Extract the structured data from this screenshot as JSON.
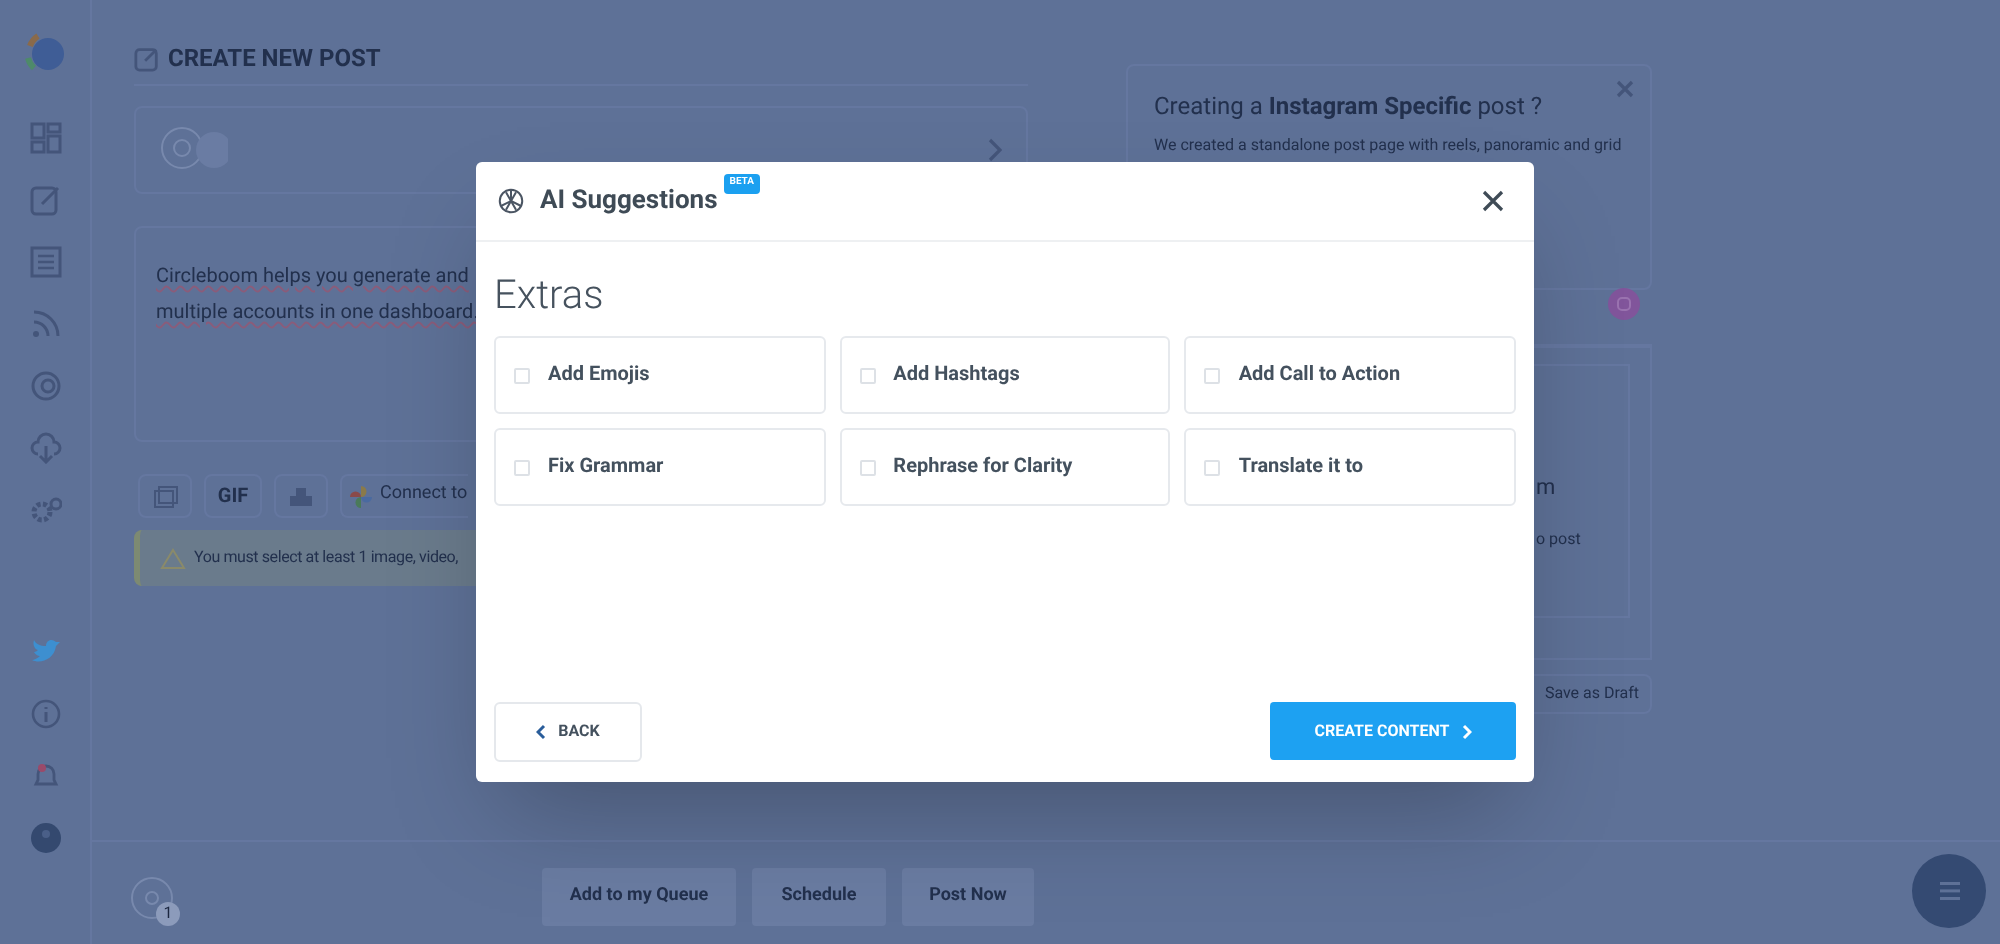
{
  "page": {
    "title": "CREATE NEW POST",
    "editor_text_lines": [
      "Circleboom helps you generate and",
      "multiple accounts in one dashboard."
    ],
    "toolbar": [
      "GIF",
      "Connect to"
    ],
    "warning": "You must select at least 1 image, video,",
    "actions": [
      "Add to my Queue",
      "Schedule",
      "Post Now"
    ],
    "account_badge": "1"
  },
  "promo": {
    "title": "Creating a **Instagram Specific** post ?",
    "text": "We created a standalone post page with reels, panoramic and grid",
    "fragments": [
      "m",
      "o post"
    ],
    "draft_button": "Save as Draft"
  },
  "modal": {
    "title": "AI Suggestions",
    "badge": "BETA",
    "section": "Extras",
    "options": [
      {
        "label": "Add Emojis",
        "checked": false
      },
      {
        "label": "Add Hashtags",
        "checked": false
      },
      {
        "label": "Add Call to Action",
        "checked": false
      },
      {
        "label": "Fix Grammar",
        "checked": false
      },
      {
        "label": "Rephrase for Clarity",
        "checked": false
      },
      {
        "label": "Translate it to",
        "checked": false
      }
    ],
    "back_button": "BACK",
    "create_button": "CREATE CONTENT"
  }
}
